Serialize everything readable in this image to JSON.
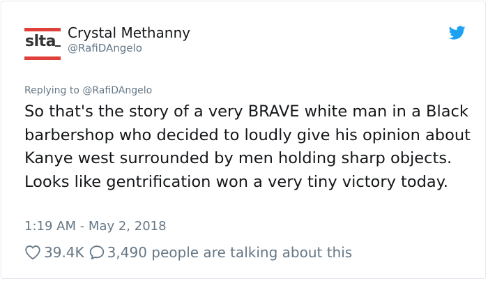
{
  "author": {
    "display_name": "Crystal Methanny",
    "handle": "@RafiDAngelo",
    "avatar_text": "slta"
  },
  "reply": {
    "prefix": "Replying to",
    "handle": "@RafiDAngelo"
  },
  "tweet": {
    "text": "So that's the story of a very BRAVE white man in a Black barbershop who decided to loudly give his opinion about Kanye west surrounded by men holding sharp objects. Looks like gentrification won a very tiny victory today.",
    "timestamp": "1:19 AM - May 2, 2018"
  },
  "actions": {
    "likes": "39.4K",
    "talking": "3,490 people are talking about this"
  },
  "icons": {
    "brand": "twitter-bird-icon",
    "like": "heart-icon",
    "reply": "speech-bubble-icon"
  },
  "colors": {
    "twitter_blue": "#1da1f2",
    "secondary_text": "#657786",
    "logo_red": "#e0403a"
  }
}
